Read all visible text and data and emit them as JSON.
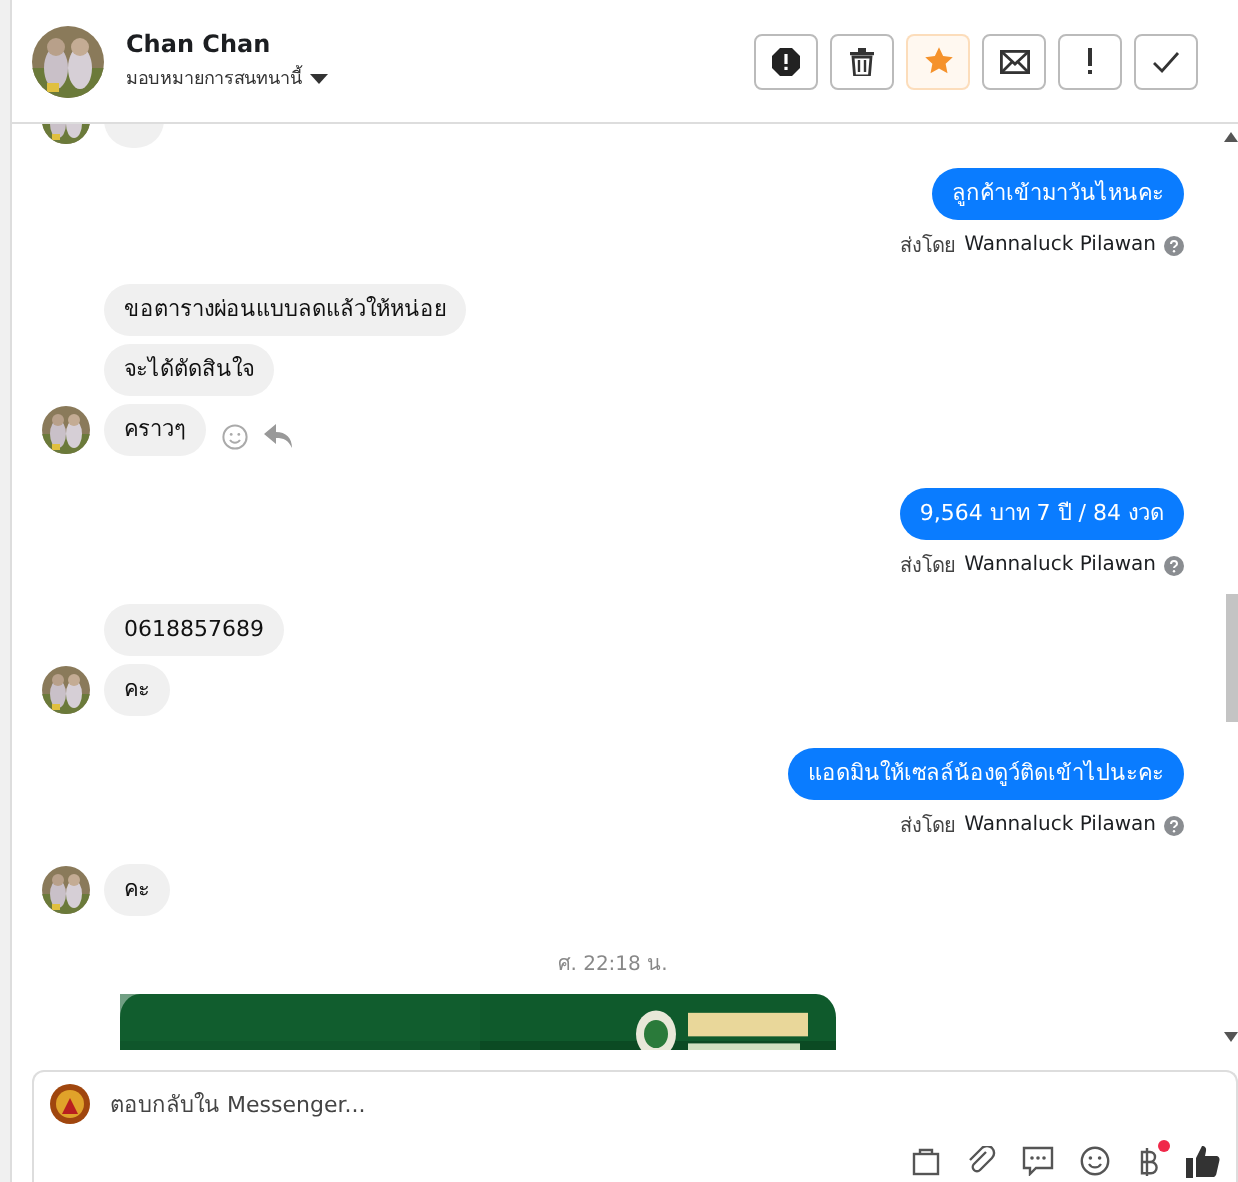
{
  "header": {
    "name": "Chan Chan",
    "assign_label": "มอบหมายการสนทนานี้",
    "actions": [
      {
        "kind": "spam"
      },
      {
        "kind": "delete"
      },
      {
        "kind": "star",
        "on": true
      },
      {
        "kind": "unread"
      },
      {
        "kind": "follow-up"
      },
      {
        "kind": "done"
      }
    ]
  },
  "messages": [
    {
      "kind": "cut"
    },
    {
      "kind": "outgoing",
      "text": "ลูกค้าเข้ามาวันไหนคะ",
      "sent_by_label": "ส่งโดย",
      "sender": "Wannaluck Pilawan"
    },
    {
      "kind": "incoming",
      "text": "ขอตารางผ่อนแบบลดแล้วให้หน่อย",
      "avatar": false,
      "show_actions": false
    },
    {
      "kind": "incoming",
      "text": "จะได้ตัดสินใจ",
      "avatar": false,
      "show_actions": false
    },
    {
      "kind": "incoming",
      "text": "คราวๆ",
      "avatar": true,
      "show_actions": true
    },
    {
      "kind": "outgoing",
      "text": "9,564 บาท  7 ปี / 84 งวด",
      "sent_by_label": "ส่งโดย",
      "sender": "Wannaluck Pilawan"
    },
    {
      "kind": "incoming",
      "text": "0618857689",
      "avatar": false,
      "show_actions": false
    },
    {
      "kind": "incoming",
      "text": "คะ",
      "avatar": true,
      "show_actions": false
    },
    {
      "kind": "outgoing",
      "text": "แอดมินให้เซลล์น้องดูว์ติดเข้าไปนะคะ",
      "sent_by_label": "ส่งโดย",
      "sender": "Wannaluck Pilawan"
    },
    {
      "kind": "incoming",
      "text": "คะ",
      "avatar": true,
      "show_actions": false
    },
    {
      "kind": "timestamp",
      "text": "ศ. 22:18 น."
    },
    {
      "kind": "picture"
    }
  ],
  "composer": {
    "placeholder": "ตอบกลับใน Messenger...",
    "tools": [
      {
        "kind": "bag"
      },
      {
        "kind": "attach"
      },
      {
        "kind": "saved-reply"
      },
      {
        "kind": "emoji"
      },
      {
        "kind": "payment",
        "badge": true
      },
      {
        "kind": "like"
      }
    ]
  }
}
